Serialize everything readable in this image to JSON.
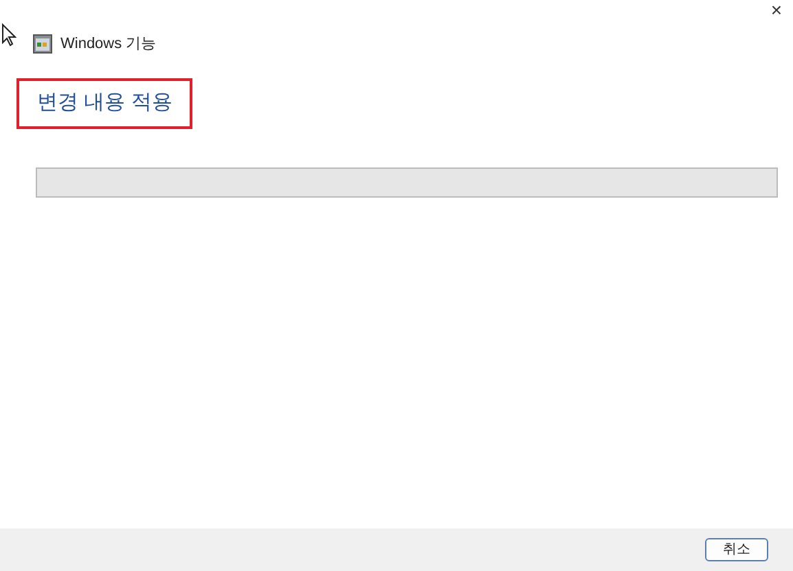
{
  "window": {
    "title": "Windows 기능",
    "close": "×"
  },
  "heading": "변경 내용 적용",
  "progress": {
    "level": 0
  },
  "buttons": [
    "취소"
  ]
}
